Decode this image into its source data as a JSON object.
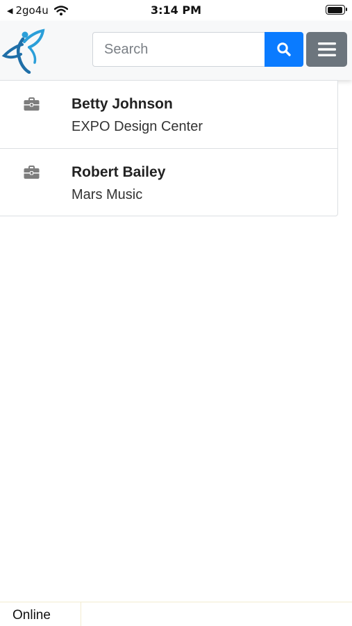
{
  "status_bar": {
    "carrier": "2go4u",
    "time": "3:14 PM"
  },
  "header": {
    "logo_icon": "butterfly-person-logo",
    "search": {
      "placeholder": "Search",
      "value": ""
    },
    "search_button_icon": "search-icon",
    "menu_button_icon": "hamburger-menu-icon"
  },
  "contacts": [
    {
      "name": "Betty Johnson",
      "company": "EXPO Design Center",
      "icon": "briefcase-icon"
    },
    {
      "name": "Robert Bailey",
      "company": "Mars Music",
      "icon": "briefcase-icon"
    }
  ],
  "footer": {
    "status": "Online"
  },
  "colors": {
    "primary": "#0a7bff",
    "secondary": "#6c757d",
    "header_bg": "#f7f8f9"
  }
}
